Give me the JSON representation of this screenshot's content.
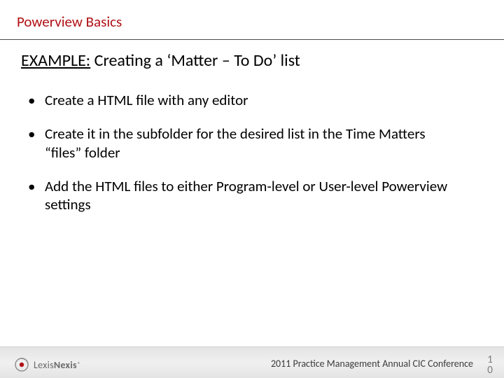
{
  "section_title": "Powerview Basics",
  "subtitle_underlined": "EXAMPLE:",
  "subtitle_rest": " Creating a ‘Matter – To Do’ list",
  "bullets": [
    "Create a HTML file with any editor",
    "Create it in the subfolder for the desired list in the Time Matters “files” folder",
    "Add the HTML files to either Program-level or User-level Powerview settings"
  ],
  "logo": {
    "lexis": "Lexis",
    "nexis": "Nexis",
    "reg": "®"
  },
  "footer_text": "2011 Practice Management Annual CIC Conference",
  "page_number_top": "1",
  "page_number_bottom": "0"
}
